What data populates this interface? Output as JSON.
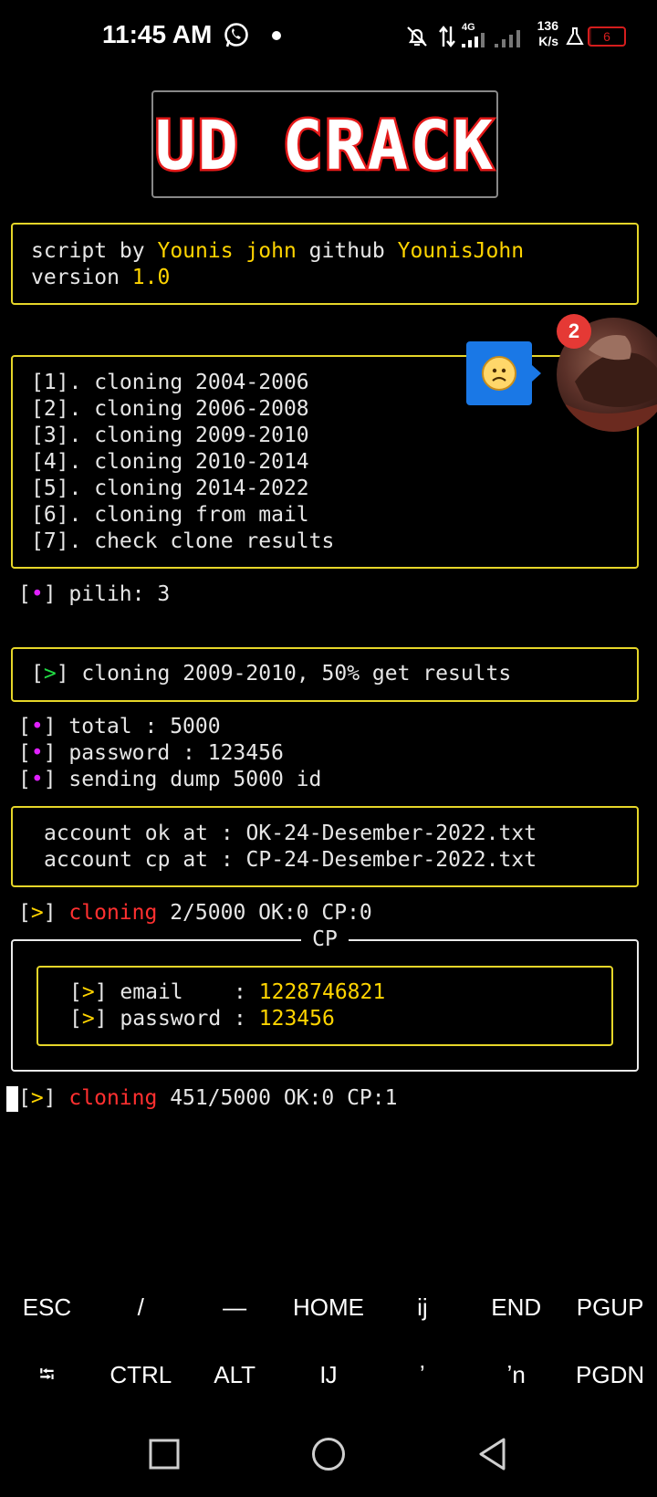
{
  "status_bar": {
    "time": "11:45 AM",
    "network_type": "4G",
    "speed_value": "136",
    "speed_unit": "K/s",
    "battery": "6",
    "battery_level": 0.06,
    "icons": [
      "whatsapp-icon",
      "bell-off-icon",
      "data-arrows-icon",
      "signal-icon",
      "signal-icon-2",
      "flask-icon",
      "battery-icon"
    ]
  },
  "logo_text": "UD CRACK",
  "info": {
    "script_by_label": "script by ",
    "author": "Younis john",
    "github_label": " github ",
    "github_user": "YounisJohn",
    "version_label": "version ",
    "version": "1.0"
  },
  "menu": [
    "[1]. cloning 2004-2006",
    "[2]. cloning 2006-2008",
    "[3]. cloning 2009-2010",
    "[4]. cloning 2010-2014",
    "[5]. cloning 2014-2022",
    "[6]. cloning from mail",
    "[7]. check clone results"
  ],
  "prompt": {
    "label": "pilih: ",
    "value": "3"
  },
  "cloning_banner": "cloning 2009-2010, 50% get results",
  "details": [
    "total : 5000",
    "password : 123456",
    "sending dump 5000 id"
  ],
  "files": [
    "account ok at : OK-24-Desember-2022.txt",
    "account cp at : CP-24-Desember-2022.txt"
  ],
  "progress1": {
    "word": "cloning",
    "rest": " 2/5000 OK:0 CP:0"
  },
  "cp_panel": {
    "title": "CP",
    "email_label": "email    : ",
    "email": "1228746821",
    "password_label": "password : ",
    "password": "123456"
  },
  "progress2": {
    "word": "cloning",
    "rest": " 451/5000 OK:0 CP:1"
  },
  "chat_head": {
    "badge": "2"
  },
  "extra_keys": {
    "row1": [
      "ESC",
      "/",
      "—",
      "HOME",
      "ij",
      "END",
      "PGUP"
    ],
    "row2": [
      "⭾",
      "CTRL",
      "ALT",
      "Ĳ",
      "ʼ",
      "ʼn",
      "PGDN"
    ]
  },
  "brackets": {
    "bullet": "•",
    "arrow": ">"
  },
  "colors": {
    "accent_yellow": "#ffd400",
    "red": "#ff3030",
    "green": "#22dd44",
    "magenta": "#e020ff",
    "box_border": "#e6d629"
  }
}
